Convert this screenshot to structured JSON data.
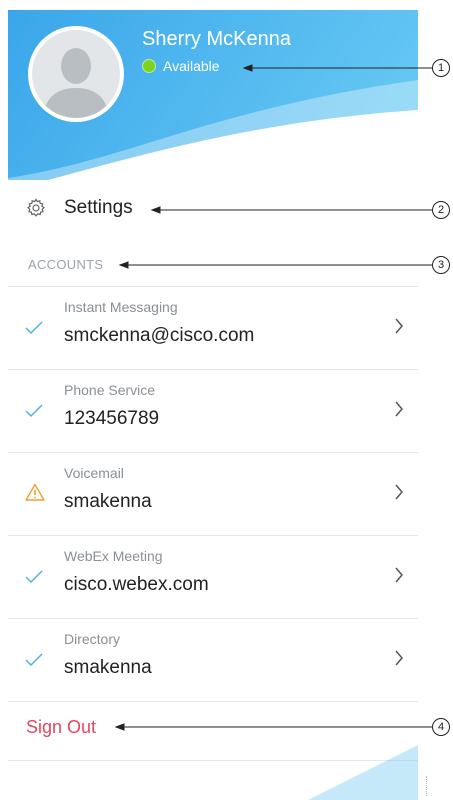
{
  "profile": {
    "name": "Sherry McKenna",
    "status": "Available",
    "status_color": "#7ed321"
  },
  "settings": {
    "label": "Settings",
    "icon": "gear-icon"
  },
  "accounts": {
    "heading": "ACCOUNTS",
    "items": [
      {
        "label": "Instant Messaging",
        "value": "smckenna@cisco.com",
        "state": "check-icon"
      },
      {
        "label": "Phone Service",
        "value": "123456789",
        "state": "check-icon"
      },
      {
        "label": "Voicemail",
        "value": "smakenna",
        "state": "warning-icon"
      },
      {
        "label": "WebEx Meeting",
        "value": "cisco.webex.com",
        "state": "check-icon"
      },
      {
        "label": "Directory",
        "value": "smakenna",
        "state": "check-icon"
      }
    ]
  },
  "signout": {
    "label": "Sign Out",
    "color": "#e0475f"
  },
  "callouts": [
    "1",
    "2",
    "3",
    "4"
  ],
  "colors": {
    "header_blue": "#46b4ee",
    "check": "#4fb3e3",
    "warning": "#f0a030"
  }
}
